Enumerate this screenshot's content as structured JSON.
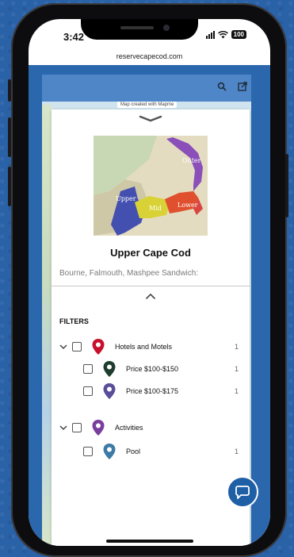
{
  "status": {
    "time": "3:42",
    "battery": "100"
  },
  "browser": {
    "url": "reservecapecod.com"
  },
  "map": {
    "credit": "Map created with Mapme",
    "search_icon": "search-icon",
    "open_external_icon": "open-external-icon"
  },
  "region": {
    "labels": {
      "outer": "Outer",
      "upper": "Upper",
      "mid": "Mid",
      "lower": "Lower"
    },
    "title": "Upper Cape Cod",
    "description": "Bourne, Falmouth, Mashpee Sandwich:"
  },
  "filters": {
    "title": "FILTERS",
    "groups": [
      {
        "label": "Hotels and Motels",
        "count": "1",
        "pin_color": "#c8102e",
        "items": [
          {
            "label": "Price $100-$150",
            "count": "1",
            "pin_color": "#1f3d2e"
          },
          {
            "label": "Price $100-$175",
            "count": "1",
            "pin_color": "#5a4e9a"
          }
        ]
      },
      {
        "label": "Activities",
        "count": "",
        "pin_color": "#7a3d9e",
        "items": [
          {
            "label": "Pool",
            "count": "1",
            "pin_color": "#3d7aa6"
          }
        ]
      }
    ]
  },
  "chat": {
    "icon": "chat-bubble-icon"
  },
  "colors": {
    "site_bg": "#2b67ad",
    "header": "#4f86c7",
    "chat": "#1f5fa6"
  }
}
